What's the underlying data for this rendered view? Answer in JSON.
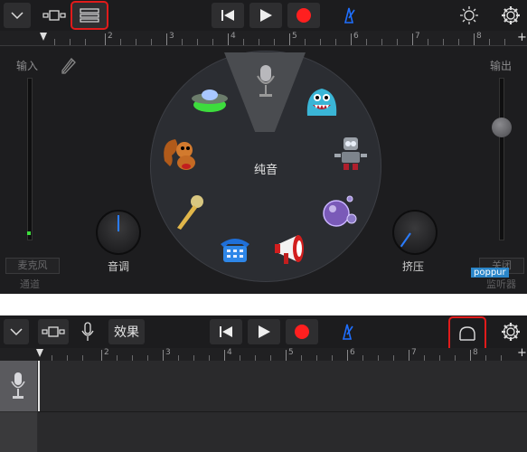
{
  "top_screen": {
    "toolbar": {
      "buttons": [
        "dropdown-menu",
        "track-view",
        "mixer-list-view",
        "rewind",
        "play",
        "record",
        "metronome",
        "settings-brightness",
        "settings-gear"
      ]
    },
    "ruler": {
      "numbers": [
        "2",
        "3",
        "4",
        "5",
        "6",
        "7",
        "8"
      ]
    },
    "input_label": "输入",
    "output_label": "输出",
    "center_label": "纯音",
    "knob_left_label": "音调",
    "knob_right_label": "挤压",
    "left_bottom_button": "麦克风",
    "left_bottom_sub": "通道",
    "right_bottom_button": "关闭",
    "right_bottom_sub": "监听器",
    "watermark": "poppur",
    "voice_presets": [
      "ufo-icon",
      "monster-icon",
      "squirrel-icon",
      "robot-icon",
      "bubbles-icon",
      "megaphone-icon",
      "telephone-icon",
      "microphone-gold-icon",
      "microphone-icon"
    ]
  },
  "bottom_screen": {
    "effects_label": "效果",
    "ruler": {
      "numbers": [
        "2",
        "3",
        "4",
        "5",
        "6",
        "7",
        "8"
      ]
    }
  },
  "colors": {
    "record": "#ff1f1f",
    "metronome": "#1f6fff",
    "highlight": "#e01b1b",
    "ufo_glow": "#3ddc3d"
  }
}
